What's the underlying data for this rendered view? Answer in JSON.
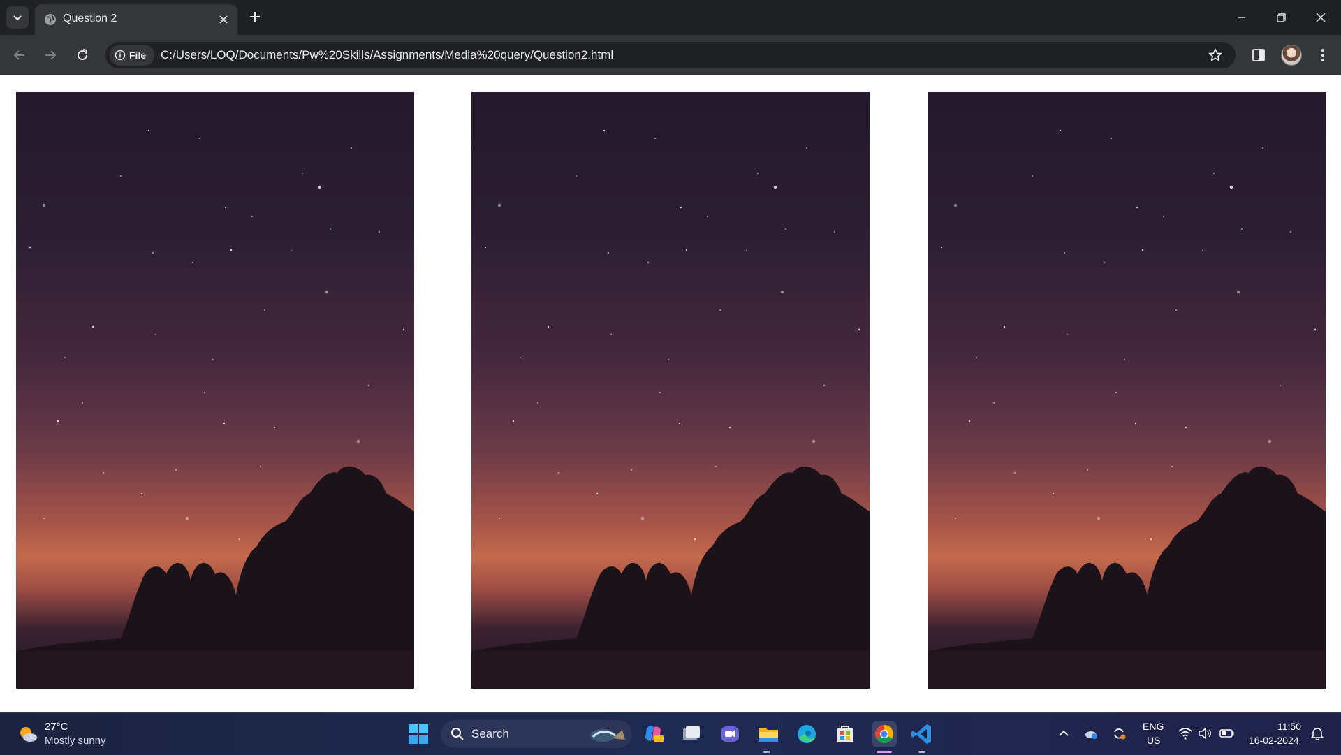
{
  "browser": {
    "tab": {
      "title": "Question 2"
    },
    "address_bar": {
      "chip_label": "File",
      "url": "C:/Users/LOQ/Documents/Pw%20Skills/Assignments/Media%20query/Question2.html"
    }
  },
  "page": {
    "images": [
      {
        "alt": "Starry night sky over silhouetted trees at sunset"
      },
      {
        "alt": "Starry night sky over silhouetted trees at sunset"
      },
      {
        "alt": "Starry night sky over silhouetted trees at sunset"
      }
    ]
  },
  "taskbar": {
    "weather": {
      "temp": "27°C",
      "condition": "Mostly sunny"
    },
    "search_label": "Search",
    "apps": [
      "start",
      "search",
      "copilot",
      "task-view",
      "teams",
      "file-explorer",
      "edge",
      "microsoft-store",
      "chrome",
      "vscode"
    ],
    "tray": {
      "lang_line1": "ENG",
      "lang_line2": "US",
      "time": "11:50",
      "date": "16-02-2024"
    }
  },
  "colors": {
    "tabbar_bg": "#202124",
    "toolbar_bg": "#35363a",
    "taskbar_bg": "#1f2a52",
    "sky_top": "#24192b",
    "sky_glow": "#c46a4c"
  }
}
